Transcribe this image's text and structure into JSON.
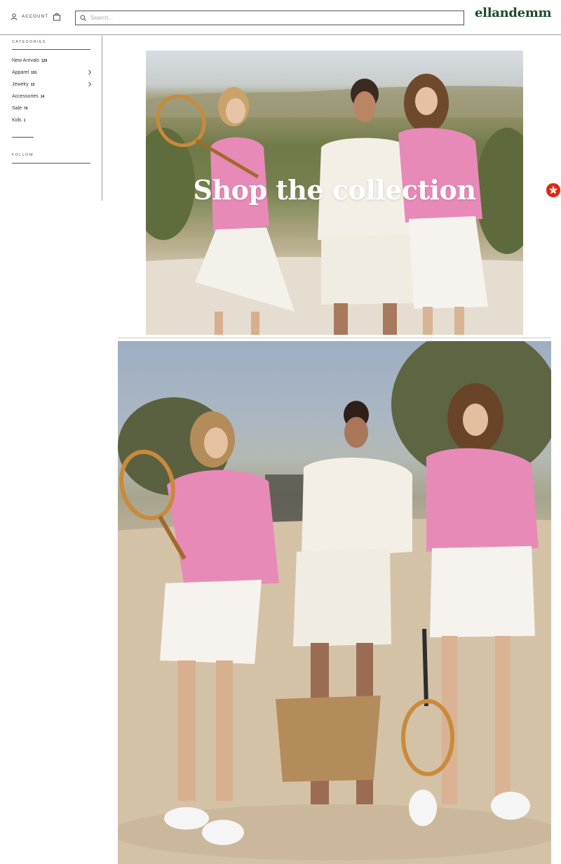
{
  "header": {
    "account_label": "ACCOUNT",
    "search_placeholder": "Search...",
    "logo": "ellandemm"
  },
  "sidebar": {
    "categories_heading": "CATEGORIES",
    "items": [
      {
        "label": "New Arrivals",
        "count": "129",
        "has_submenu": false
      },
      {
        "label": "Apparel",
        "count": "191",
        "has_submenu": true
      },
      {
        "label": "Jewelry",
        "count": "13",
        "has_submenu": true
      },
      {
        "label": "Accessories",
        "count": "14",
        "has_submenu": false
      },
      {
        "label": "Sale",
        "count": "70",
        "has_submenu": false
      },
      {
        "label": "Kids",
        "count": "1",
        "has_submenu": false
      }
    ],
    "follow_heading": "FOLLOW"
  },
  "hero": {
    "title": "Shop the collection"
  },
  "icons": {
    "account": "user-icon",
    "bag": "shopping-bag-icon",
    "search": "search-icon",
    "chevron": "chevron-right-icon",
    "flag": "hong-kong-flag-icon"
  },
  "colors": {
    "logo": "#1d4a2a",
    "flag": "#de2910",
    "sweater_pink": "#e88ab8",
    "cream": "#f3efe6"
  }
}
